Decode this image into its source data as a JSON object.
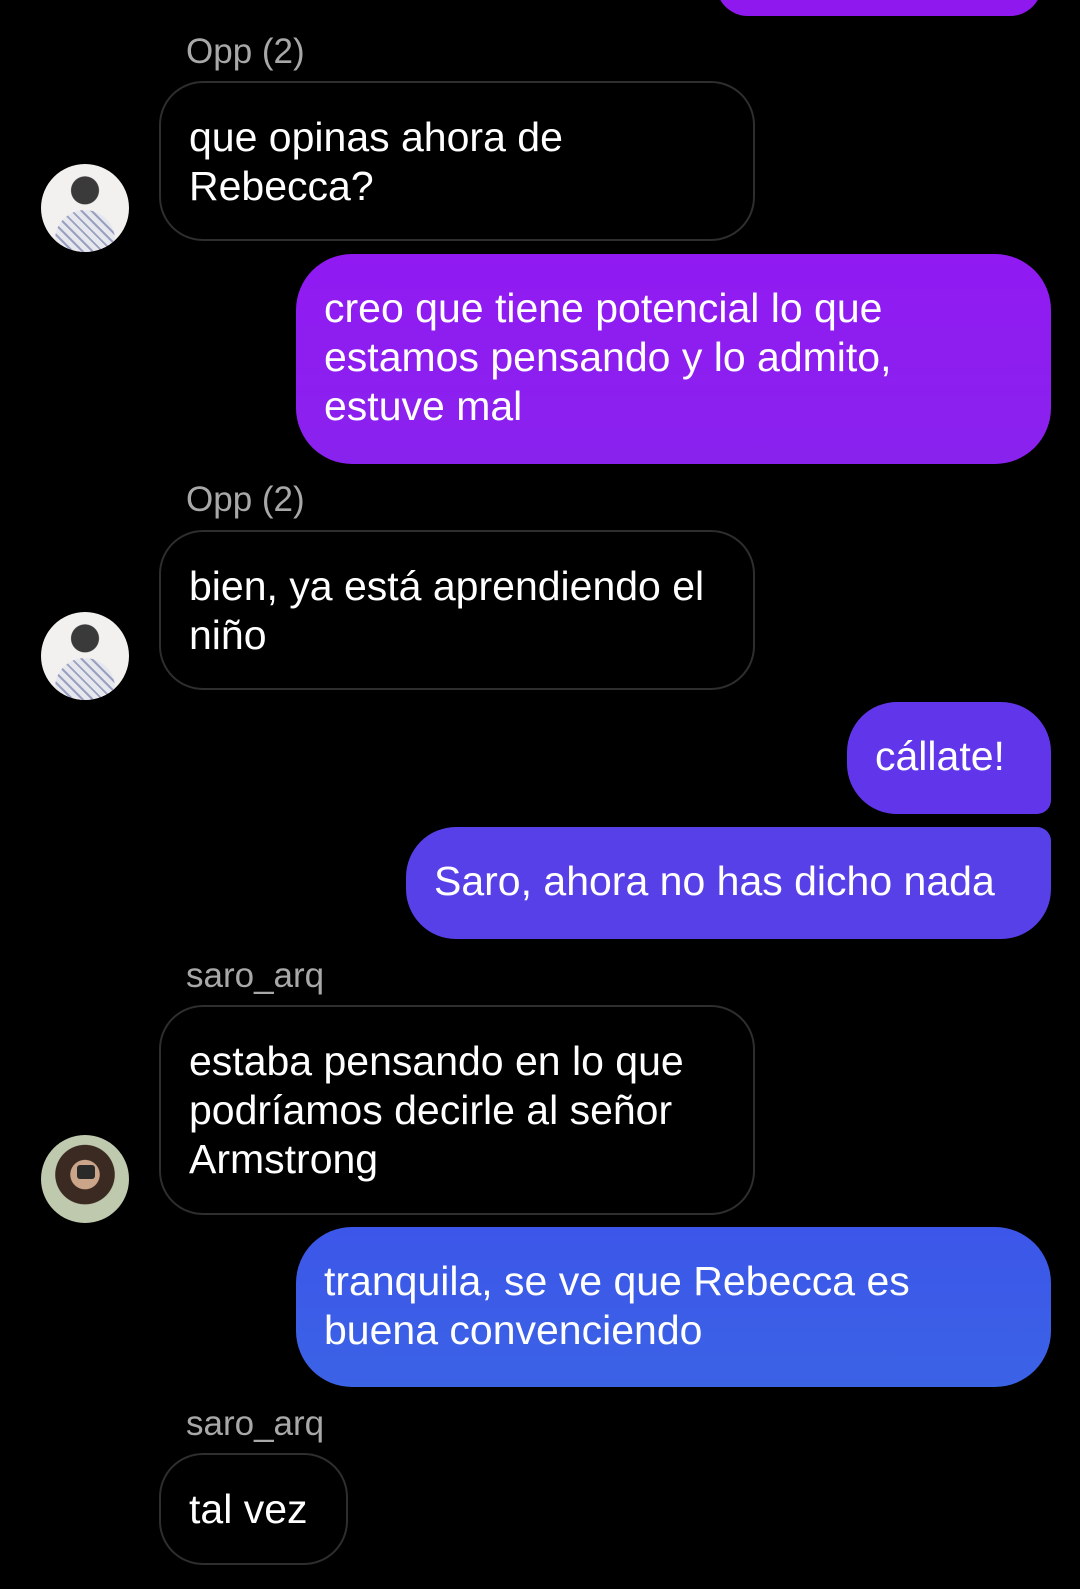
{
  "messages": [
    {
      "sender": "Opp (2)",
      "text": "que opinas ahora de Rebecca?"
    },
    {
      "text": "creo que tiene potencial lo que estamos pensando y lo admito, estuve mal",
      "color": "#8c1df0"
    },
    {
      "sender": "Opp (2)",
      "text": "bien, ya está aprendiendo el niño"
    },
    {
      "text": "cállate!",
      "color": "#6136ea"
    },
    {
      "text": "Saro, ahora no has dicho nada",
      "color": "#5740e8"
    },
    {
      "sender": "saro_arq",
      "text": "estaba pensando en lo que podríamos decirle al señor Armstrong"
    },
    {
      "text": "tranquila, se ve que Rebecca es buena convenciendo",
      "color": "#3c5de8"
    },
    {
      "sender": "saro_arq",
      "text": "tal vez"
    }
  ]
}
